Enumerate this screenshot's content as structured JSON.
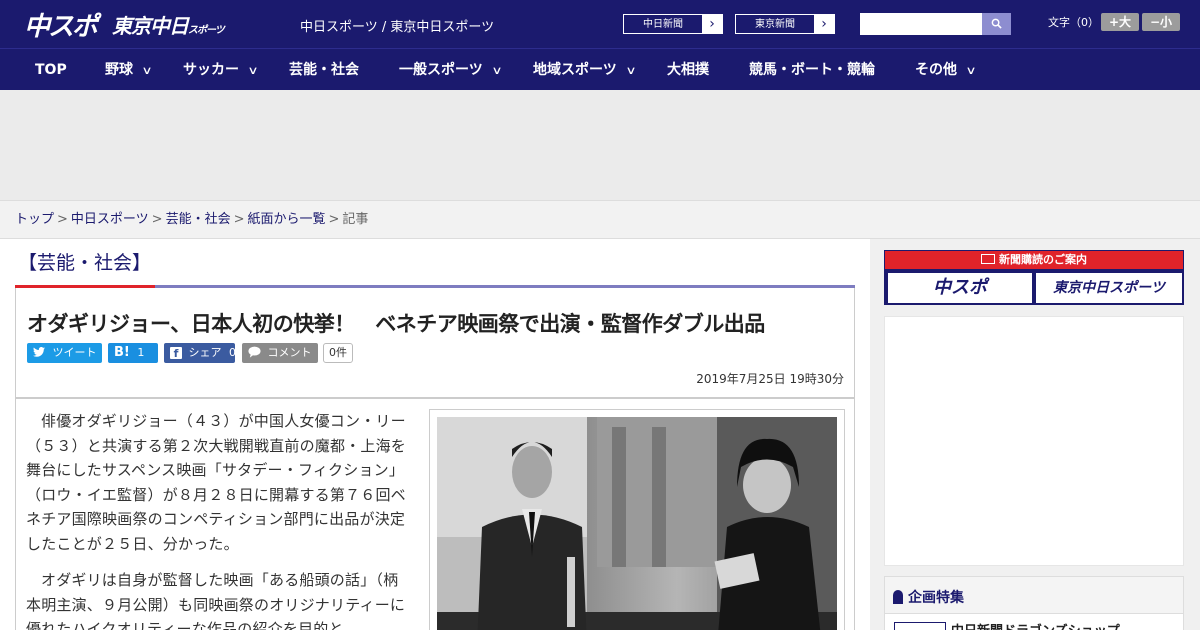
{
  "header": {
    "logo_chuspo": "中スポ",
    "logo_tokyo": "東京中日",
    "logo_tokyo_small": "スポーツ",
    "site_links": "中日スポーツ / 東京中日スポーツ",
    "paper_buttons": [
      {
        "label": "中日新聞",
        "arrow": "›"
      },
      {
        "label": "東京新聞",
        "arrow": "›"
      }
    ],
    "search": {
      "placeholder": "",
      "button_icon": "search-icon",
      "button_glyph": "⚲"
    },
    "font_size": {
      "label": "文字（0）",
      "larger": "+大",
      "smaller": "−小"
    }
  },
  "nav": {
    "items": [
      {
        "label": "TOP",
        "has_dropdown": false
      },
      {
        "label": "野球",
        "has_dropdown": true
      },
      {
        "label": "サッカー",
        "has_dropdown": true
      },
      {
        "label": "芸能・社会",
        "has_dropdown": false
      },
      {
        "label": "一般スポーツ",
        "has_dropdown": true
      },
      {
        "label": "地域スポーツ",
        "has_dropdown": true
      },
      {
        "label": "大相撲",
        "has_dropdown": false
      },
      {
        "label": "競馬・ボート・競輪",
        "has_dropdown": false
      },
      {
        "label": "その他",
        "has_dropdown": true
      }
    ],
    "chevron": "∨"
  },
  "breadcrumb": {
    "items": [
      "トップ",
      "中日スポーツ",
      "芸能・社会",
      "紙面から一覧"
    ],
    "current": "記事",
    "separator": ">"
  },
  "article": {
    "category": "【芸能・社会】",
    "title": "オダギリジョー、日本人初の快挙！　ベネチア映画祭で出演・監督作ダブル出品",
    "share": {
      "tweet": "ツイート",
      "hatena": "B!",
      "hatena_count": "1",
      "facebook": "シェア",
      "facebook_count": "0",
      "comment": "コメント",
      "comment_count": "0件"
    },
    "date": "2019年7月25日 19時30分",
    "paragraphs": [
      "俳優オダギリジョー（４３）が中国人女優コン・リー（５３）と共演する第２次大戦開戦直前の魔都・上海を舞台にしたサスペンス映画「サタデー・フィクション」（ロウ・イエ監督）が８月２８日に開幕する第７６回ベネチア国際映画祭のコンペティション部門に出品が決定したことが２５日、分かった。",
      "オダギリは自身が監督した映画「ある船頭の話」（柄本明主演、９月公開）も同映画祭のオリジナリティーに優れたハイクオリティーな作品の紹介を目的と"
    ]
  },
  "sidebar": {
    "promo_title": "新聞購読のご案内",
    "promo_logos": [
      "中スポ",
      "東京中日スポーツ"
    ],
    "panel_title": "企画特集",
    "panel_item": "中日新聞ドラゴンズショップ"
  },
  "colors": {
    "brand_navy": "#1b1a6e",
    "accent_red": "#e0232a",
    "twitter": "#1c9be6",
    "hatena": "#1a8fe0",
    "facebook": "#3b5ba0"
  }
}
